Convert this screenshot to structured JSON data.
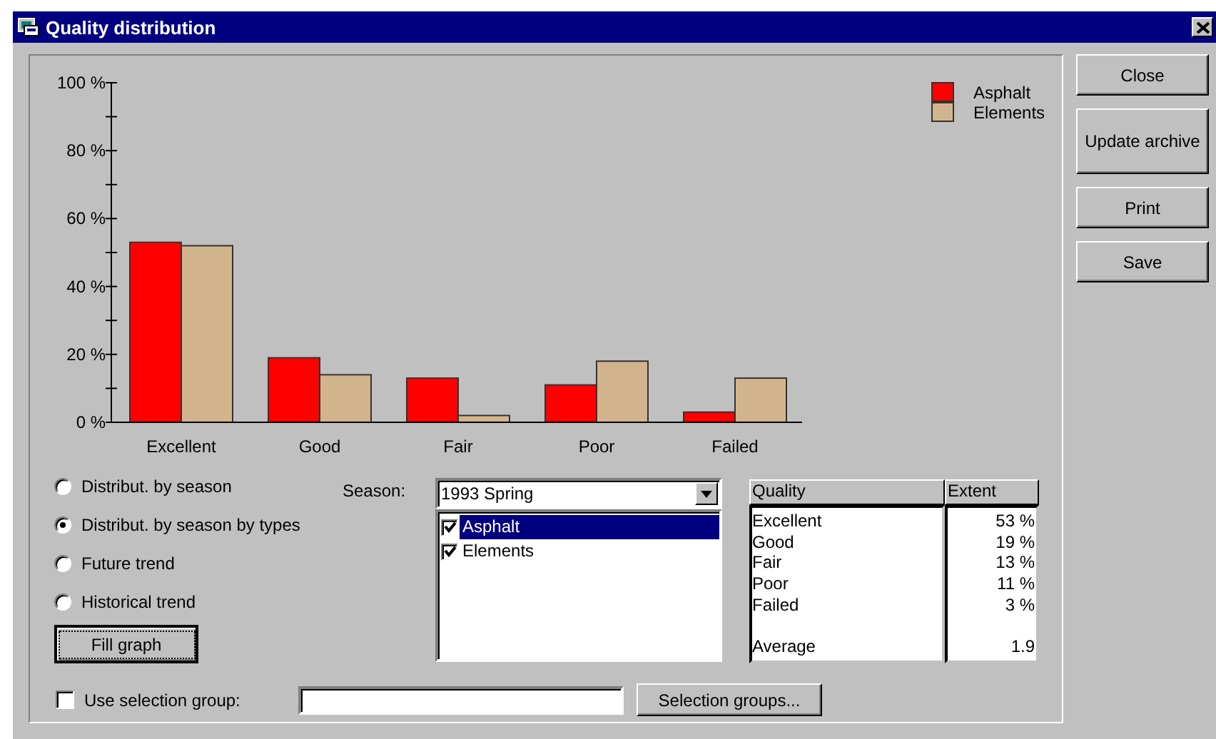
{
  "window": {
    "title": "Quality distribution"
  },
  "chart": {
    "chart_data": {
      "type": "bar",
      "categories": [
        "Excellent",
        "Good",
        "Fair",
        "Poor",
        "Failed"
      ],
      "series": [
        {
          "name": "Asphalt",
          "color": "#ff0000",
          "values": [
            53,
            19,
            13,
            11,
            3
          ]
        },
        {
          "name": "Elements",
          "color": "#d2b48c",
          "values": [
            52,
            14,
            2,
            18,
            13
          ]
        }
      ],
      "ylim": [
        0,
        100
      ],
      "legend": true,
      "yticks": [
        {
          "value": 0,
          "label": "0 %"
        },
        {
          "value": 20,
          "label": "20 %"
        },
        {
          "value": 40,
          "label": "40 %"
        },
        {
          "value": 60,
          "label": "60 %"
        },
        {
          "value": 80,
          "label": "80 %"
        },
        {
          "value": 100,
          "label": "100 %"
        }
      ]
    }
  },
  "options": [
    {
      "label": "Distribut. by season",
      "selected": false
    },
    {
      "label": "Distribut. by season by types",
      "selected": true
    },
    {
      "label": "Future trend",
      "selected": false
    },
    {
      "label": "Historical trend",
      "selected": false
    }
  ],
  "fill_button": "Fill graph",
  "season": {
    "label": "Season:",
    "value": "1993 Spring"
  },
  "types": [
    {
      "label": "Asphalt",
      "checked": true,
      "selected": true
    },
    {
      "label": "Elements",
      "checked": true,
      "selected": false
    }
  ],
  "table": {
    "columns": [
      "Quality",
      "Extent"
    ],
    "rows": [
      {
        "quality": "Excellent",
        "extent": "53 %"
      },
      {
        "quality": "Good",
        "extent": "19 %"
      },
      {
        "quality": "Fair",
        "extent": "13 %"
      },
      {
        "quality": "Poor",
        "extent": "11 %"
      },
      {
        "quality": "Failed",
        "extent": "3 %"
      }
    ],
    "average": {
      "quality": "Average",
      "extent": "1.9"
    }
  },
  "selection_group": {
    "label": "Use selection group:",
    "checked": false
  },
  "selection_groups_button": "Selection groups...",
  "buttons": [
    "Close",
    "Update archive",
    "Print",
    "Save"
  ]
}
